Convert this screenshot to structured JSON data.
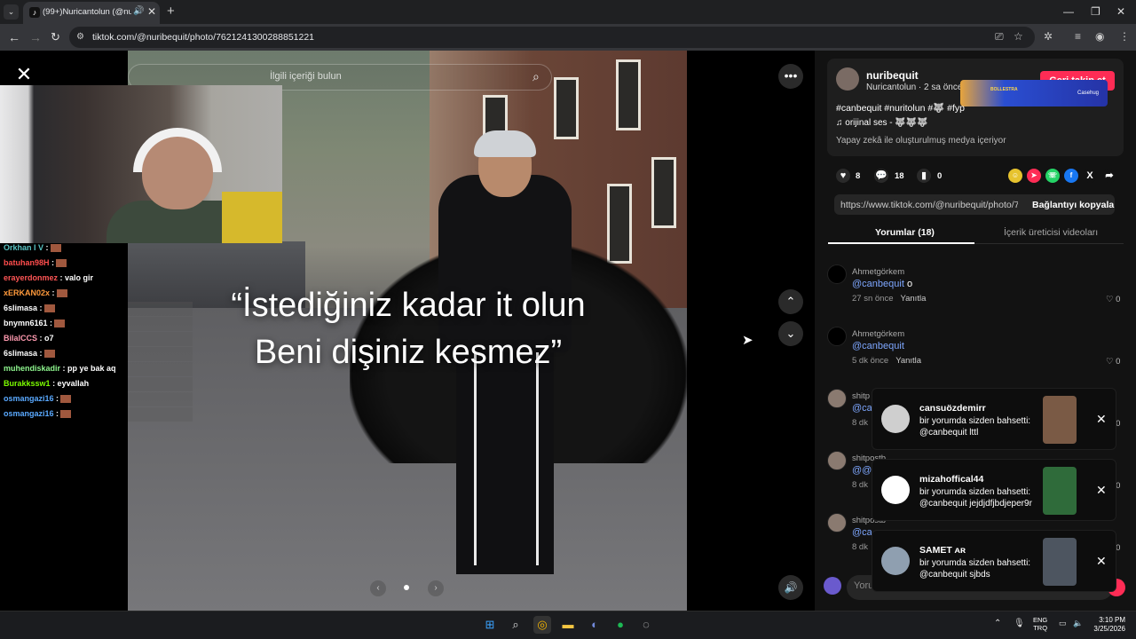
{
  "browser": {
    "tab_title": "(99+)Nuricantolun (@nurib",
    "url": "tiktok.com/@nuribequit/photo/7621241300288851221"
  },
  "photo": {
    "search_placeholder": "İlgili içeriği bulun",
    "quote_line1": "“İstediğiniz kadar it olun",
    "quote_line2": "Beni dişiniz kesmez”"
  },
  "chat": [
    {
      "user": "Orkhan I V",
      "msg": ":",
      "color": "#59c3c3",
      "emote": true
    },
    {
      "user": "batuhan98H",
      "msg": ":",
      "color": "#ff4d4d",
      "emote": true
    },
    {
      "user": "erayerdonmez",
      "msg": ": valo gir",
      "color": "#ff5555",
      "emote": false
    },
    {
      "user": "xERKAN02x",
      "msg": ":",
      "color": "#ff9a3c",
      "emote": true
    },
    {
      "user": "6slimasa",
      "msg": ":",
      "color": "#ffffff",
      "emote": true
    },
    {
      "user": "bnymn6161",
      "msg": ":",
      "color": "#ffffff",
      "emote": true
    },
    {
      "user": "BilalCCS",
      "msg": ": o7",
      "color": "#ff9ab0",
      "emote": false
    },
    {
      "user": "6slimasa",
      "msg": ":",
      "color": "#ffffff",
      "emote": true
    },
    {
      "user": "muhendiskadir",
      "msg": ": pp ye bak aq",
      "color": "#8ef58e",
      "emote": false
    },
    {
      "user": "Burakkssw1",
      "msg": ": eyvallah",
      "color": "#7cfc00",
      "emote": false
    },
    {
      "user": "osmangazi16",
      "msg": ":",
      "color": "#5aa9ff",
      "emote": true
    },
    {
      "user": "osmangazi16",
      "msg": ":",
      "color": "#5aa9ff",
      "emote": true
    }
  ],
  "post": {
    "username": "nuribequit",
    "subline": "Nuricantolun · 2 sa önce",
    "follow_label": "Geri takip et",
    "hashtags": "#canbequit #nuritolun #🐺 #fyp",
    "music": "♫  orijinal ses - 🐺🐺🐺",
    "ai_note": "Yapay zekâ ile oluşturulmuş medya içeriyor",
    "likes": "8",
    "comments": "18",
    "saves": "0",
    "link": "https://www.tiktok.com/@nuribequit/photo/7...",
    "copy_label": "Bağlantıyı kopyala",
    "tab_comments": "Yorumlar (18)",
    "tab_creator": "İçerik üreticisi videoları",
    "comment_placeholder": "Yorum ekle..."
  },
  "ad": {
    "text1": "BOLLESTRA",
    "text2": "Casehug"
  },
  "comments": [
    {
      "user": "Ahmetgörkem",
      "mention": "@canbequit",
      "text": "o",
      "time": "27 sn önce",
      "reply": "Yanıtla",
      "likes": "0"
    },
    {
      "user": "Ahmetgörkem",
      "mention": "@canbequit",
      "text": "",
      "time": "5 dk önce",
      "reply": "Yanıtla",
      "likes": "0"
    },
    {
      "user": "shitp",
      "mention": "@ca",
      "text": "",
      "time": "8 dk",
      "reply": "",
      "likes": "0"
    },
    {
      "user": "shitpostb",
      "mention": "@@",
      "text": "",
      "time": "8 dk",
      "reply": "",
      "likes": "0"
    },
    {
      "user": "shitpostb",
      "mention": "@ca",
      "text": "",
      "time": "8 dk",
      "reply": "",
      "likes": "0"
    }
  ],
  "notifications": [
    {
      "user": "cansuözdemirr",
      "line1": "bir yorumda sizden bahsetti:",
      "line2": "@canbequit lttl"
    },
    {
      "user": "mizahoffical44",
      "line1": "bir yorumda sizden bahsetti:",
      "line2": "@canbequit jejdjdfjbdjeper9r"
    },
    {
      "user": "SAMET ᴀʀ",
      "line1": "bir yorumda sizden bahsetti:",
      "line2": "@canbequit sjbds"
    }
  ],
  "taskbar": {
    "lang1": "ENG",
    "lang2": "TRQ",
    "time": "3:10 PM",
    "date": "3/25/2026"
  },
  "colors": {
    "accent": "#fe2c55",
    "mention": "#7ea7ff"
  }
}
